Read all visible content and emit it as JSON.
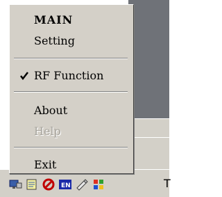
{
  "menu": {
    "items": [
      {
        "label": "MAIN",
        "checked": false,
        "enabled": true,
        "bold": true
      },
      {
        "label": "Setting",
        "checked": false,
        "enabled": true,
        "bold": false
      },
      {
        "label": "RF Function",
        "checked": true,
        "enabled": true,
        "bold": false
      },
      {
        "label": "About",
        "checked": false,
        "enabled": true,
        "bold": false
      },
      {
        "label": "Help",
        "checked": false,
        "enabled": false,
        "bold": false
      },
      {
        "label": "Exit",
        "checked": false,
        "enabled": true,
        "bold": false
      }
    ]
  },
  "taskbar": {
    "tray_icons": [
      "network-icon",
      "notepad-icon",
      "antivirus-icon",
      "keyboard-layout-icon",
      "pen-icon",
      "windows-flag-icon"
    ],
    "clock_partial": "T"
  },
  "colors": {
    "menu_bg": "#d4d0c8",
    "disabled_text": "#a7a49d",
    "background": "#6f7278"
  }
}
